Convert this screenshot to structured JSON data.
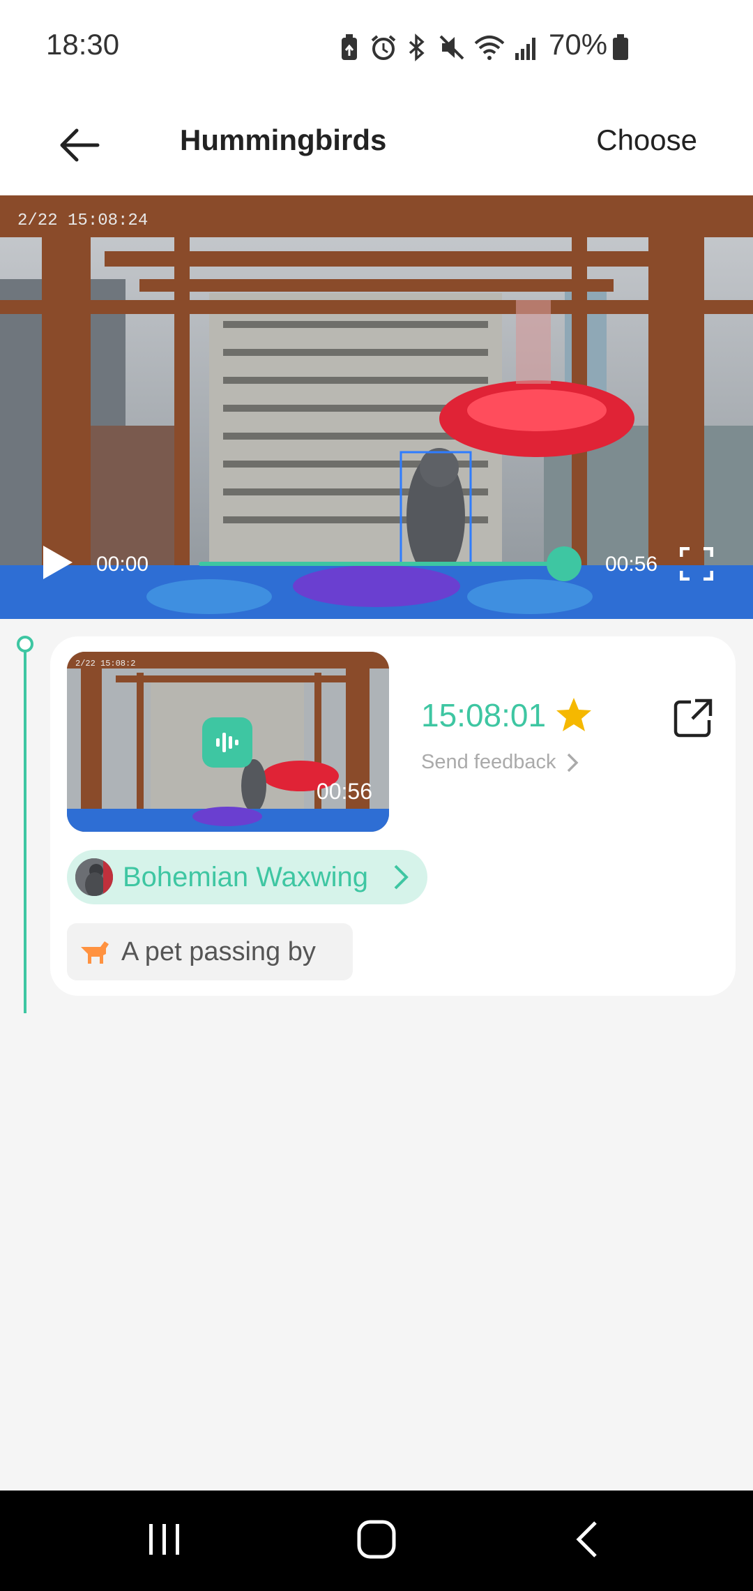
{
  "status_bar": {
    "time": "18:30",
    "battery_percent": "70%",
    "icons": [
      "battery-saver-icon",
      "alarm-icon",
      "bluetooth-icon",
      "mute-icon",
      "wifi-icon",
      "signal-icon",
      "battery-icon"
    ]
  },
  "header": {
    "title": "Hummingbirds",
    "choose_label": "Choose",
    "back_icon": "arrow-left-icon"
  },
  "player": {
    "overlay_timestamp": "2/22 15:08:24",
    "current_time": "00:00",
    "duration": "00:56",
    "progress": 0.97,
    "accent_color": "#3ec6a2"
  },
  "event": {
    "thumbnail_timestamp": "2/22 15:08:2",
    "thumbnail_duration": "00:56",
    "time": "15:08:01",
    "starred": true,
    "feedback_label": "Send feedback",
    "species_label": "Bohemian Waxwing",
    "pet_label": "A pet passing by"
  },
  "nav_bar": {
    "buttons": [
      "recent-apps-icon",
      "home-icon",
      "back-icon"
    ]
  }
}
